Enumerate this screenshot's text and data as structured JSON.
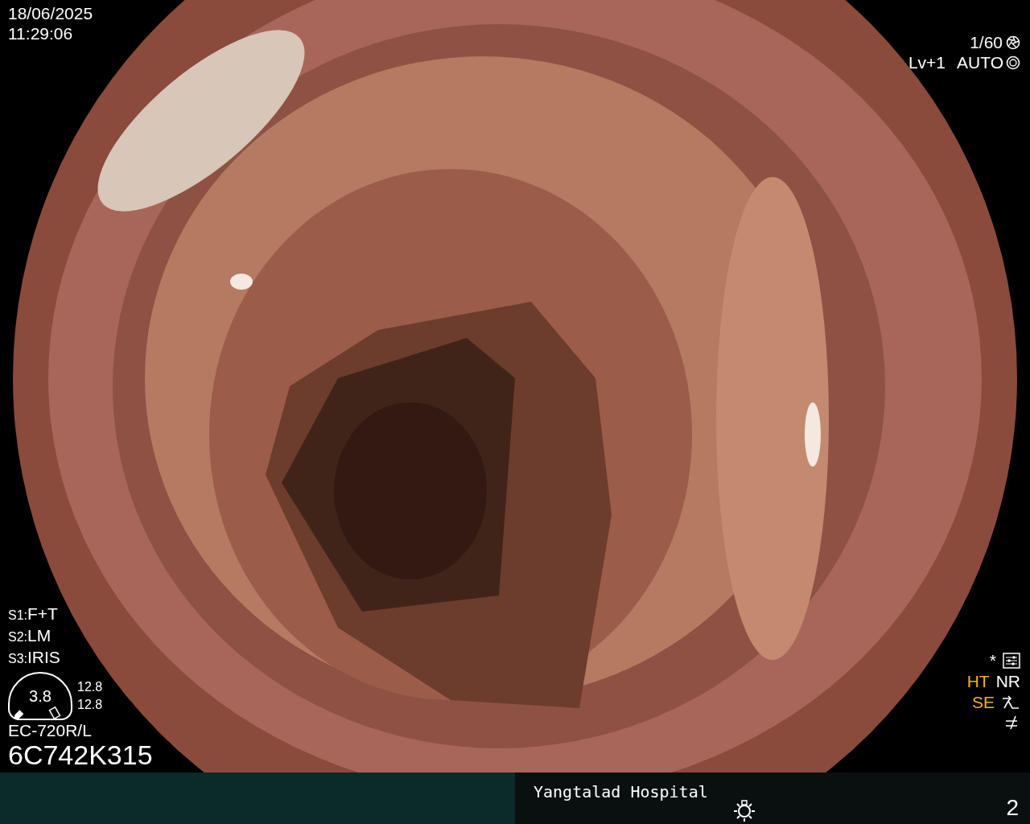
{
  "datetime": {
    "date": "18/06/2025",
    "time": "11:29:06"
  },
  "exposure": {
    "shutter": "1/60",
    "level": "Lv+1",
    "mode": "AUTO"
  },
  "switches": [
    {
      "key": "S1:",
      "value": "F+T"
    },
    {
      "key": "S2:",
      "value": "LM"
    },
    {
      "key": "S3:",
      "value": "IRIS"
    }
  ],
  "gauge": {
    "value": "3.8",
    "readings": [
      "12.8",
      "12.8"
    ]
  },
  "scope": {
    "model": "EC-720R/L",
    "serial": "6C742K315"
  },
  "enhancement": {
    "mark": "*",
    "rows": [
      [
        {
          "label": "HT",
          "active": true
        },
        {
          "label": "NR",
          "active": false
        }
      ],
      [
        {
          "label": "SE",
          "active": true
        }
      ]
    ]
  },
  "status_bar": {
    "hospital": "Yangtalad Hospital",
    "page": "2"
  }
}
